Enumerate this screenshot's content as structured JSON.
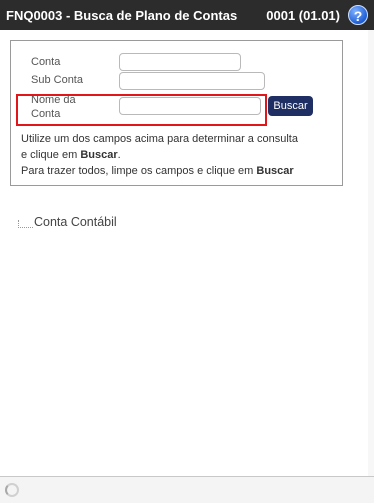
{
  "header": {
    "title": "FNQ0003 - Busca de Plano de Contas",
    "code": "0001 (01.01)",
    "help_label": "?"
  },
  "form": {
    "conta_label": "Conta",
    "conta_value": "",
    "subconta_label": "Sub Conta",
    "subconta_value": "",
    "nome_label_1": "Nome da",
    "nome_label_2": "Conta",
    "nome_value": "",
    "search_button": "Buscar"
  },
  "help": {
    "line1": "Utilize um dos campos acima para determinar a consulta",
    "line2_prefix": "e clique em ",
    "line2_bold": "Buscar",
    "line2_suffix": ".",
    "line3_prefix": "Para trazer todos, limpe os campos e clique em ",
    "line3_bold": "Buscar"
  },
  "tree": {
    "root_label": "Conta Contábil"
  }
}
